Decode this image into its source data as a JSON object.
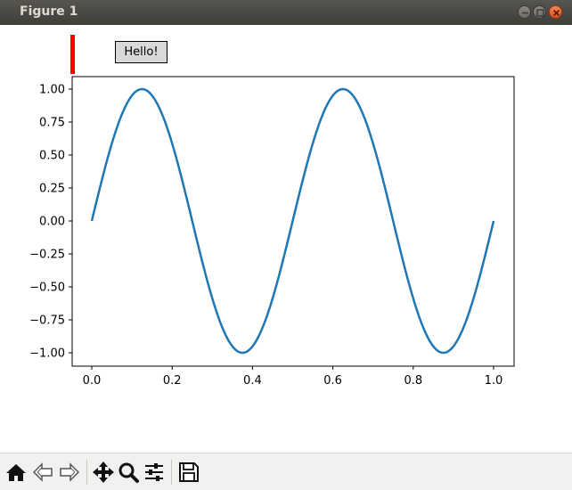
{
  "window": {
    "title": "Figure 1"
  },
  "widgets": {
    "button_label": "Hello!",
    "indicator_color": "#ff0000"
  },
  "toolbar": {
    "icons": [
      "home-icon",
      "back-icon",
      "forward-icon",
      "pan-icon",
      "zoom-icon",
      "configure-subplots-icon",
      "save-icon"
    ]
  },
  "chart_data": {
    "type": "line",
    "title": "",
    "xlabel": "",
    "ylabel": "",
    "xlim": [
      0.0,
      1.0
    ],
    "ylim": [
      -1.0,
      1.0
    ],
    "xticks": [
      "0.0",
      "0.2",
      "0.4",
      "0.6",
      "0.8",
      "1.0"
    ],
    "yticks": [
      "1.00",
      "0.75",
      "0.50",
      "0.25",
      "0.00",
      "−0.25",
      "−0.50",
      "−0.75",
      "−1.00"
    ],
    "grid": false,
    "series": [
      {
        "function": "sin(4πx)",
        "color": "#1f77b4",
        "x": [
          0.0,
          0.05,
          0.1,
          0.125,
          0.15,
          0.2,
          0.25,
          0.3,
          0.35,
          0.375,
          0.4,
          0.45,
          0.5,
          0.55,
          0.6,
          0.625,
          0.65,
          0.7,
          0.75,
          0.8,
          0.85,
          0.875,
          0.9,
          0.95,
          1.0
        ],
        "y": [
          0.0,
          0.588,
          0.951,
          1.0,
          0.951,
          0.588,
          0.0,
          -0.588,
          -0.951,
          -1.0,
          -0.951,
          -0.588,
          0.0,
          0.588,
          0.951,
          1.0,
          0.951,
          0.588,
          0.0,
          -0.588,
          -0.951,
          -1.0,
          -0.951,
          -0.588,
          0.0
        ]
      }
    ]
  }
}
